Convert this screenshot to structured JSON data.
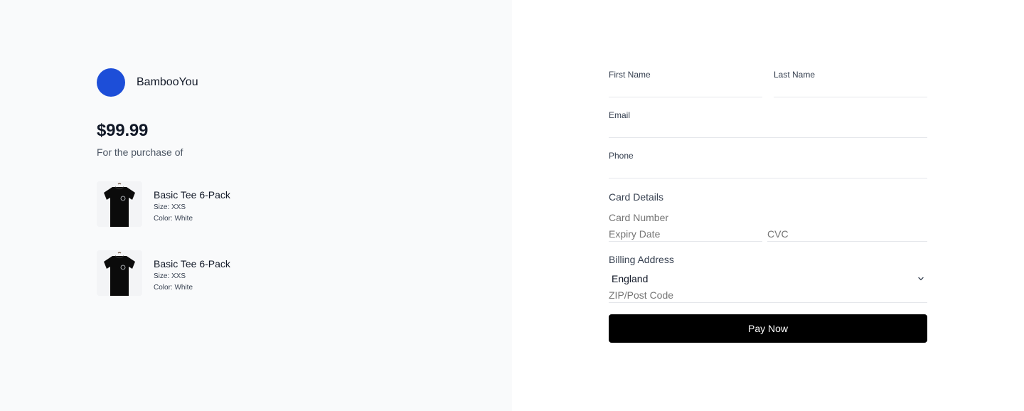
{
  "brand": {
    "name": "BambooYou",
    "logo_color": "#1d4ed8"
  },
  "summary": {
    "price": "$99.99",
    "purchase_label": "For the purchase of"
  },
  "items": [
    {
      "name": "Basic Tee 6-Pack",
      "size": "Size: XXS",
      "color": "Color: White",
      "image_icon": "tshirt-icon"
    },
    {
      "name": "Basic Tee 6-Pack",
      "size": "Size: XXS",
      "color": "Color: White",
      "image_icon": "tshirt-icon"
    }
  ],
  "form": {
    "first_name_label": "First Name",
    "last_name_label": "Last Name",
    "email_label": "Email",
    "phone_label": "Phone",
    "first_name_value": "",
    "last_name_value": "",
    "email_value": "",
    "phone_value": "",
    "card_details_title": "Card Details",
    "card_number_placeholder": "Card Number",
    "expiry_placeholder": "Expiry Date",
    "cvc_placeholder": "CVC",
    "billing_title": "Billing Address",
    "country_selected": "England",
    "zip_placeholder": "ZIP/Post Code",
    "pay_label": "Pay Now"
  },
  "colors": {
    "left_bg": "#f9fafb",
    "accent": "#1d4ed8",
    "button_bg": "#000000",
    "button_text": "#ffffff"
  }
}
